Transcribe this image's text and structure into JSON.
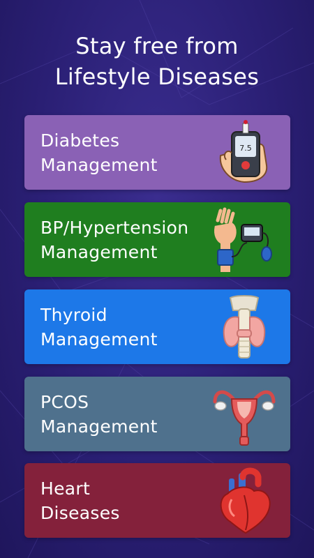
{
  "header": {
    "line1": "Stay free from",
    "line2": "Lifestyle Diseases"
  },
  "cards": [
    {
      "line1": "Diabetes",
      "line2": "Management",
      "color": "#8a61b5",
      "icon": "glucometer-icon"
    },
    {
      "line1": "BP/Hypertension",
      "line2": "Management",
      "color": "#1f7e1f",
      "icon": "blood-pressure-monitor-icon"
    },
    {
      "line1": "Thyroid",
      "line2": "Management",
      "color": "#1d78e8",
      "icon": "thyroid-gland-icon"
    },
    {
      "line1": "PCOS",
      "line2": "Management",
      "color": "#4f718d",
      "icon": "uterus-ovaries-icon"
    },
    {
      "line1": "Heart",
      "line2": "Diseases",
      "color": "#84213b",
      "icon": "heart-icon"
    }
  ],
  "glucometer": {
    "reading": "7.5"
  }
}
